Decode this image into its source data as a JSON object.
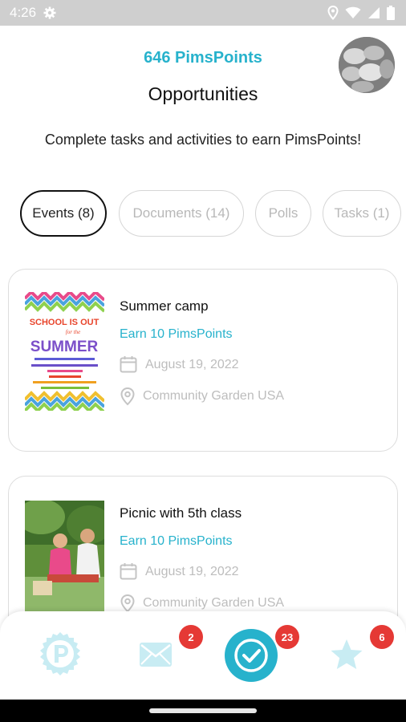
{
  "status_bar": {
    "time": "4:26"
  },
  "header": {
    "points": "646 PimsPoints",
    "title": "Opportunities",
    "subtitle": "Complete tasks and activities to earn PimsPoints!"
  },
  "tabs": [
    {
      "label": "Events (8)",
      "active": true
    },
    {
      "label": "Documents (14)",
      "active": false
    },
    {
      "label": "Polls",
      "active": false
    },
    {
      "label": "Tasks (1)",
      "active": false
    }
  ],
  "events": [
    {
      "name": "Summer camp",
      "earn": "Earn 10 PimsPoints",
      "date": "August 19, 2022",
      "location": "Community Garden USA",
      "flyer": {
        "line1": "SCHOOL IS OUT",
        "line2": "for the",
        "line3": "SUMMER"
      }
    },
    {
      "name": "Picnic with 5th class",
      "earn": "Earn 10 PimsPoints",
      "date": "August 19, 2022",
      "location": "Community Garden USA"
    }
  ],
  "bottom_nav": {
    "messages_badge": "2",
    "opportunities_badge": "23",
    "favorites_badge": "6"
  },
  "colors": {
    "accent": "#27b2cc",
    "badge": "#e53935",
    "muted_icon": "#c8ecf3"
  }
}
